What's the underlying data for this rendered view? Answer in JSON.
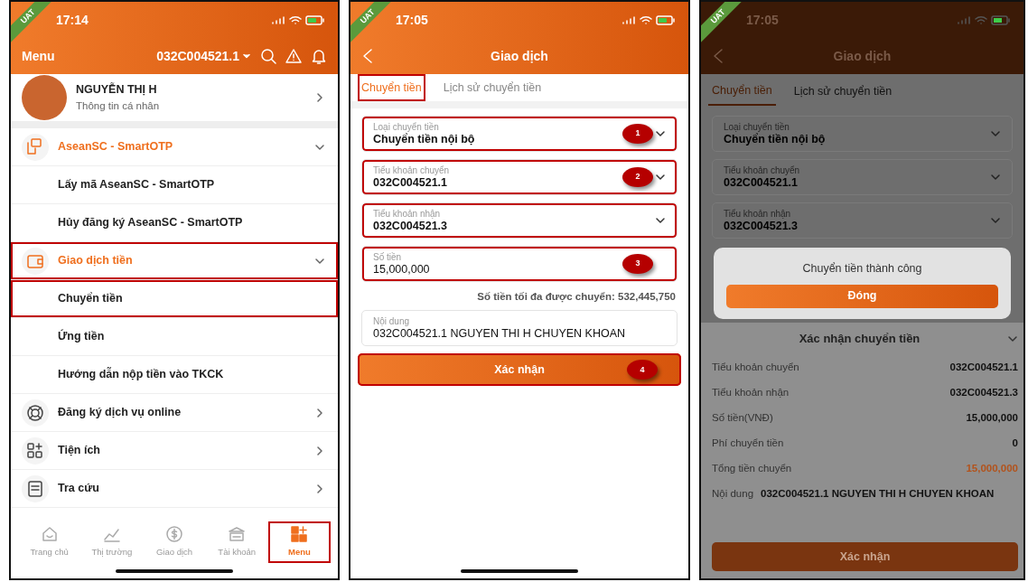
{
  "menu_screen": {
    "time": "17:14",
    "env_badge": "UAT",
    "title": "Menu",
    "account": "032C004521.1",
    "profile": {
      "name": "NGUYỄN THỊ H",
      "subtitle": "Thông tin cá nhân"
    },
    "sections": [
      {
        "label": "AseanSC - SmartOTP",
        "expanded": true,
        "highlighted": false,
        "children": [
          {
            "label": "Lấy mã AseanSC - SmartOTP",
            "highlighted": false
          },
          {
            "label": "Hủy đăng ký AseanSC - SmartOTP",
            "highlighted": false
          }
        ]
      },
      {
        "label": "Giao dịch tiền",
        "expanded": true,
        "highlighted": true,
        "children": [
          {
            "label": "Chuyển tiền",
            "highlighted": true
          },
          {
            "label": "Ứng tiền",
            "highlighted": false
          },
          {
            "label": "Hướng dẫn nộp tiền vào TKCK",
            "highlighted": false
          }
        ]
      },
      {
        "label": "Đăng ký dịch vụ online",
        "expanded": false,
        "highlighted": false
      },
      {
        "label": "Tiện ích",
        "expanded": false,
        "highlighted": false
      },
      {
        "label": "Tra cứu",
        "expanded": false,
        "highlighted": false
      }
    ],
    "tabbar": [
      {
        "label": "Trang chủ",
        "selected": false,
        "highlighted": false
      },
      {
        "label": "Thị trường",
        "selected": false,
        "highlighted": false
      },
      {
        "label": "Giao dịch",
        "selected": false,
        "highlighted": false
      },
      {
        "label": "Tài khoản",
        "selected": false,
        "highlighted": false
      },
      {
        "label": "Menu",
        "selected": true,
        "highlighted": true
      }
    ]
  },
  "transfer_screen": {
    "time": "17:05",
    "env_badge": "UAT",
    "title": "Giao dịch",
    "tabs": [
      {
        "label": "Chuyển tiền",
        "selected": true,
        "highlighted": true
      },
      {
        "label": "Lịch sử chuyển tiền",
        "selected": false,
        "highlighted": false
      }
    ],
    "fields": [
      {
        "kind": "select",
        "label": "Loại chuyển tiền",
        "value": "Chuyển tiền nội bộ",
        "step": "1",
        "highlighted": true
      },
      {
        "kind": "select",
        "label": "Tiểu khoản chuyển",
        "value": "032C004521.1",
        "step": "2",
        "highlighted": true
      },
      {
        "kind": "select",
        "label": "Tiểu khoản nhận",
        "value": "032C004521.3",
        "highlighted": true
      },
      {
        "kind": "input",
        "label": "Số tiền",
        "value": "15,000,000",
        "step": "3",
        "highlighted": true
      }
    ],
    "max_note": "Số tiền tối đa được chuyển: 532,445,750",
    "content_field": {
      "label": "Nội dung",
      "value": "032C004521.1 NGUYEN THI H CHUYEN KHOAN"
    },
    "confirm_button": {
      "label": "Xác nhận",
      "step": "4",
      "highlighted": true
    }
  },
  "success_screen": {
    "time": "17:05",
    "env_badge": "UAT",
    "title": "Giao dịch",
    "tabs": [
      {
        "label": "Chuyển tiền",
        "selected": true
      },
      {
        "label": "Lịch sử chuyển tiền",
        "selected": false
      }
    ],
    "fields": [
      {
        "label": "Loại chuyển tiền",
        "value": "Chuyển tiền nội bộ"
      },
      {
        "label": "Tiểu khoản chuyển",
        "value": "032C004521.1"
      },
      {
        "label": "Tiểu khoản nhận",
        "value": "032C004521.3"
      }
    ],
    "dialog": {
      "message": "Chuyển tiền thành công",
      "button": "Đóng"
    },
    "sheet": {
      "title": "Xác nhận chuyển tiền",
      "rows": [
        {
          "label": "Tiểu khoản chuyển",
          "value": "032C004521.1",
          "accent": false
        },
        {
          "label": "Tiểu khoản nhận",
          "value": "032C004521.3",
          "accent": false
        },
        {
          "label": "Số tiền(VNĐ)",
          "value": "15,000,000",
          "accent": false
        },
        {
          "label": "Phí chuyển tiền",
          "value": "0",
          "accent": false
        },
        {
          "label": "Tổng tiền chuyển",
          "value": "15,000,000",
          "accent": true
        }
      ],
      "content": {
        "label": "Nội dung",
        "value": "032C004521.1 NGUYEN THI H CHUYEN KHOAN"
      },
      "button": "Xác nhận"
    }
  }
}
